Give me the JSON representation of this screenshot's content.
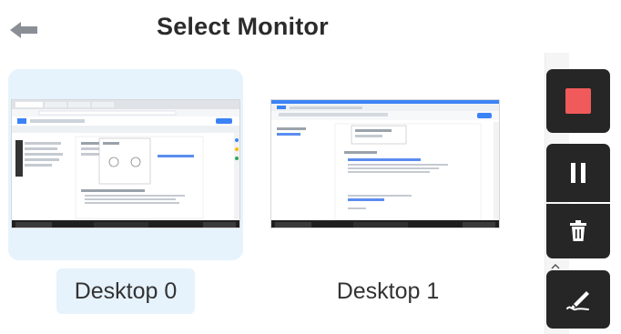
{
  "header": {
    "title": "Select Monitor",
    "back_icon": "arrow-left-icon"
  },
  "monitors": [
    {
      "label": "Desktop 0",
      "selected": true
    },
    {
      "label": "Desktop 1",
      "selected": false
    }
  ],
  "toolbar": {
    "stop_icon": "stop-icon",
    "pause_icon": "pause-icon",
    "delete_icon": "trash-icon",
    "draw_icon": "pen-icon"
  },
  "colors": {
    "selected_bg": "#e6f3fd",
    "toolbar_bg": "#262626",
    "stop_red": "#f05a5a",
    "back_arrow": "#8a8f96"
  }
}
